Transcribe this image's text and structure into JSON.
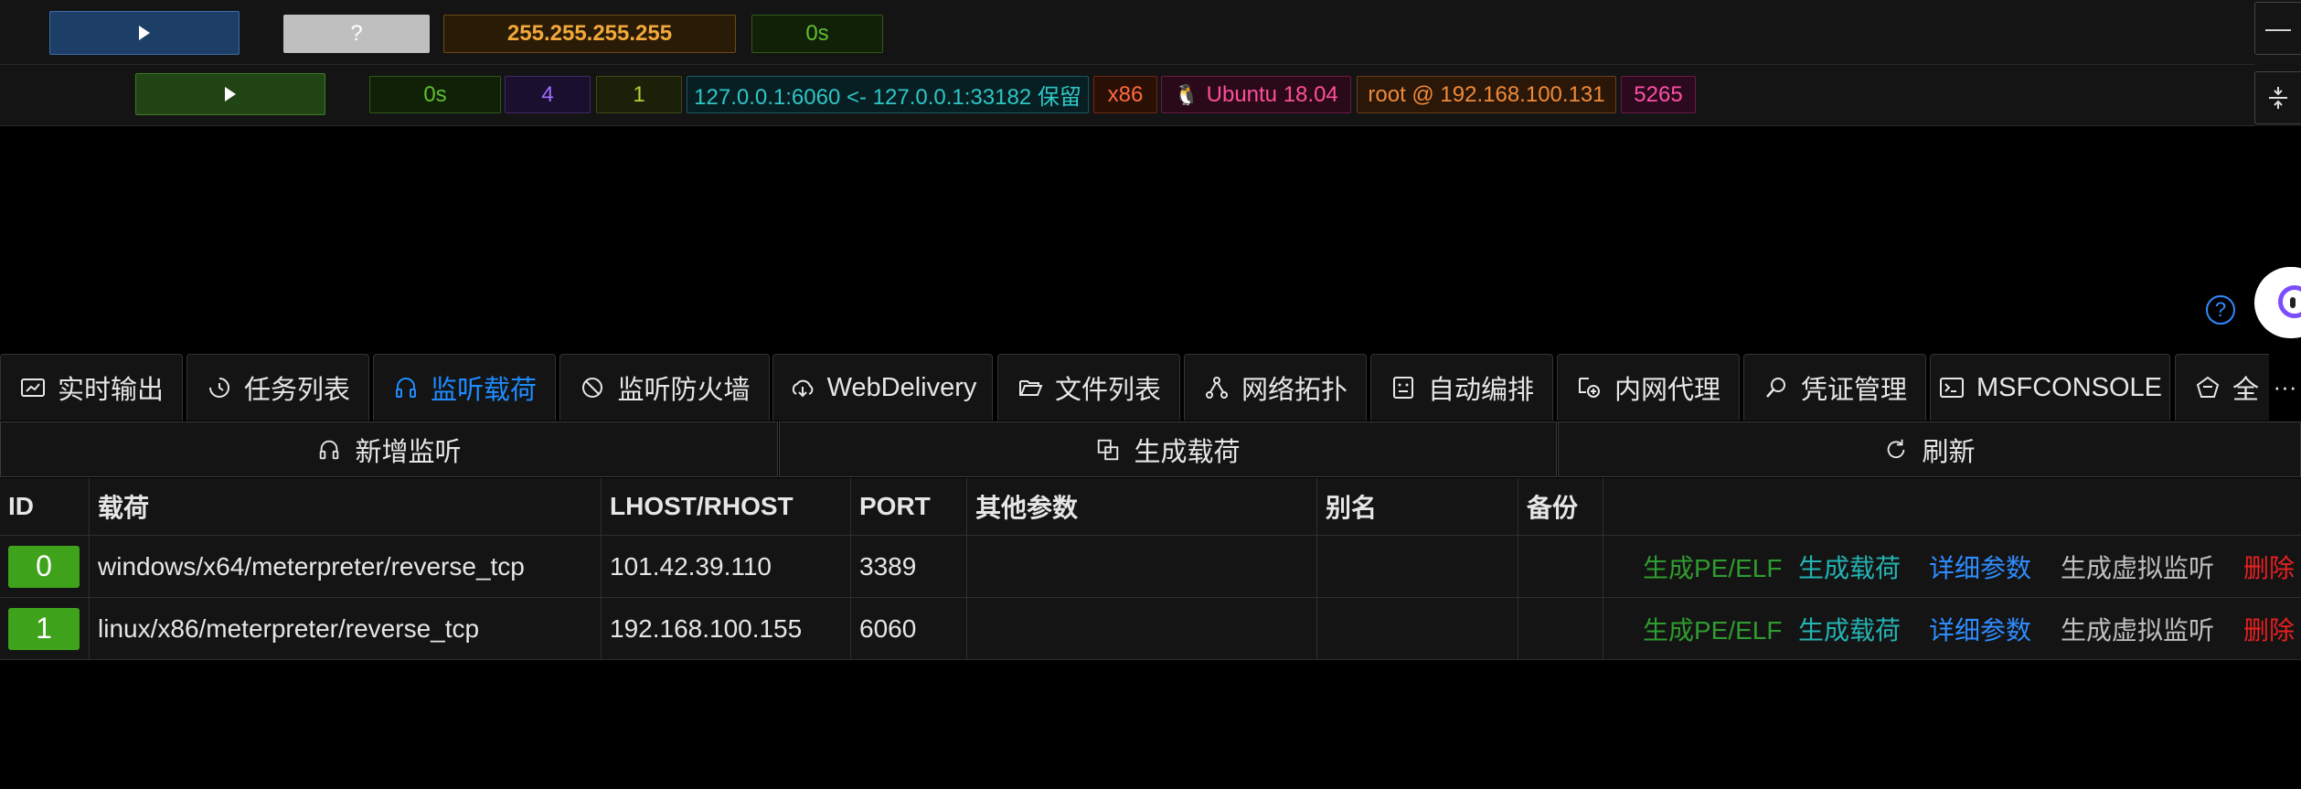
{
  "session_row_1": {
    "ip": "255.255.255.255",
    "unknown_badge": "?",
    "time": "0s"
  },
  "session_row_2": {
    "time": "0s",
    "count_a": "4",
    "count_b": "1",
    "connection": "127.0.0.1:6060 <- 127.0.0.1:33182 保留",
    "arch": "x86",
    "os": "Ubuntu 18.04",
    "user_host": "root @ 192.168.100.131",
    "pid": "5265"
  },
  "help_icon": "?",
  "tabs": [
    {
      "label": "实时输出",
      "icon": "dashboard-icon"
    },
    {
      "label": "任务列表",
      "icon": "history-icon"
    },
    {
      "label": "监听载荷",
      "icon": "headphones-icon",
      "active": true
    },
    {
      "label": "监听防火墙",
      "icon": "stop-icon"
    },
    {
      "label": "WebDelivery",
      "icon": "cloud-download-icon"
    },
    {
      "label": "文件列表",
      "icon": "folder-open-icon"
    },
    {
      "label": "网络拓扑",
      "icon": "network-icon"
    },
    {
      "label": "自动编排",
      "icon": "robot-icon"
    },
    {
      "label": "内网代理",
      "icon": "proxy-icon"
    },
    {
      "label": "凭证管理",
      "icon": "key-icon"
    },
    {
      "label": "MSFCONSOLE",
      "icon": "terminal-icon"
    },
    {
      "label": "全",
      "icon": "gem-icon"
    }
  ],
  "tab_overflow": "···",
  "actions": {
    "add_listener": "新增监听",
    "generate_payload": "生成载荷",
    "refresh": "刷新"
  },
  "table": {
    "headers": [
      "ID",
      "载荷",
      "LHOST/RHOST",
      "PORT",
      "其他参数",
      "别名",
      "备份"
    ],
    "rows": [
      {
        "id": "0",
        "payload": "windows/x64/meterpreter/reverse_tcp",
        "host": "101.42.39.110",
        "port": "3389",
        "other": "",
        "alias": "",
        "backup": ""
      },
      {
        "id": "1",
        "payload": "linux/x86/meterpreter/reverse_tcp",
        "host": "192.168.100.155",
        "port": "6060",
        "other": "",
        "alias": "",
        "backup": ""
      }
    ],
    "row_actions": {
      "gen_pe_elf": "生成PE/ELF",
      "gen_payload": "生成载荷",
      "details": "详细参数",
      "gen_virtual": "生成虚拟监听",
      "delete": "删除"
    }
  },
  "colors": {
    "active_tab": "#1e8cff",
    "id_badge": "#3ea21b",
    "gen_pe_elf": "#2f9c2f",
    "gen_payload": "#25b3b3",
    "details": "#2f8cff",
    "gen_virtual": "#bfbfbf",
    "delete": "#e62020"
  }
}
